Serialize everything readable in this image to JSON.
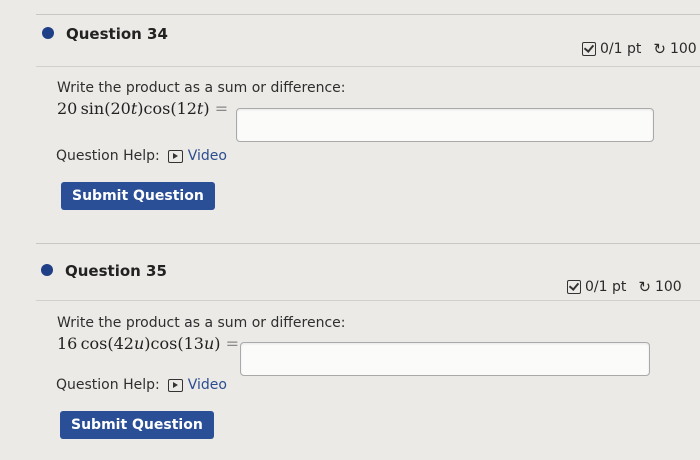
{
  "questions": [
    {
      "title": "Question 34",
      "score": "0/1 pt",
      "retries": "100",
      "prompt": "Write the product as a sum or difference:",
      "expression": {
        "coef": "20",
        "f1": "sin",
        "a1": "20",
        "v": "t",
        "f2": "cos",
        "a2": "12"
      },
      "help_label": "Question Help:",
      "video_label": "Video",
      "submit_label": "Submit Question"
    },
    {
      "title": "Question 35",
      "score": "0/1 pt",
      "retries": "100",
      "prompt": "Write the product as a sum or difference:",
      "expression": {
        "coef": "16",
        "f1": "cos",
        "a1": "42",
        "v": "u",
        "f2": "cos",
        "a2": "13"
      },
      "help_label": "Question Help:",
      "video_label": "Video",
      "submit_label": "Submit Question"
    }
  ],
  "colors": {
    "accent": "#1f3f86",
    "button": "#2b4f96",
    "link": "#2b4d8f"
  },
  "icons": [
    "bullet-dot-icon",
    "checkbox-score-icon",
    "retry-icon",
    "video-icon"
  ]
}
